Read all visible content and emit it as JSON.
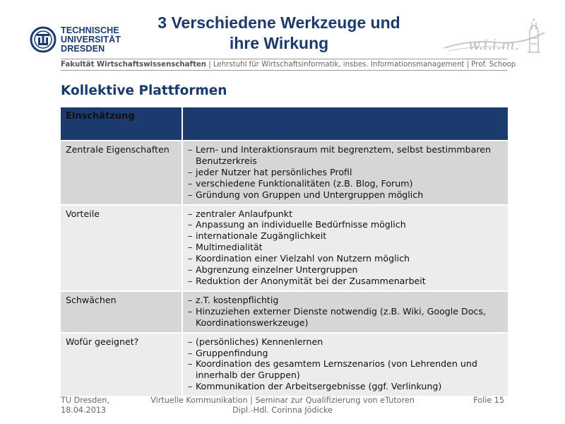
{
  "header": {
    "logo_lines": [
      "TECHNISCHE",
      "UNIVERSITÄT",
      "DRESDEN"
    ],
    "title_lines": [
      "3 Verschiedene Werkzeuge und",
      "ihre Wirkung"
    ],
    "wiim_logo_text": "w.i.i.m.",
    "faculty_bold": "Fakultät Wirtschaftswissenschaften",
    "faculty_rest": " | Lehrstuhl für Wirtschaftsinformatik, insbes. Informationsmanagement | Prof. Schoop"
  },
  "section_title": "Kollektive Plattformen",
  "table": {
    "header": [
      "Einschätzung",
      ""
    ],
    "rows": [
      {
        "label": "Zentrale Eigenschaften",
        "points": [
          "Lern- und Interaktionsraum mit begrenztem, selbst bestimmbaren Benutzerkreis",
          "jeder Nutzer hat persönliches Profil",
          "verschiedene Funktionalitäten (z.B. Blog, Forum)",
          "Gründung von Gruppen und Untergruppen möglich"
        ]
      },
      {
        "label": "Vorteile",
        "points": [
          "zentraler Anlaufpunkt",
          "Anpassung an individuelle Bedürfnisse möglich",
          "internationale Zugänglichkeit",
          "Multimedialität",
          "Koordination einer Vielzahl von Nutzern möglich",
          "Abgrenzung einzelner Untergruppen",
          "Reduktion der Anonymität bei der Zusammenarbeit"
        ]
      },
      {
        "label": "Schwächen",
        "points": [
          "z.T. kostenpflichtig",
          "Hinzuziehen externer Dienste notwendig (z.B. Wiki, Google Docs, Koordinationswerkzeuge)"
        ]
      },
      {
        "label": "Wofür geeignet?",
        "points": [
          "(persönliches) Kennenlernen",
          "Gruppenfindung",
          "Koordination des gesamtem Lernszenarios (von Lehrenden und innerhalb der Gruppen)",
          "Kommunikation der Arbeitsergebnisse (ggf. Verlinkung)"
        ]
      }
    ]
  },
  "footer": {
    "left_lines": [
      "TU Dresden,",
      "18.04.2013"
    ],
    "center_lines": [
      "Virtuelle Kommunikation | Seminar zur Qualifizierung von eTutoren",
      "Dipl.-Hdl. Corinna Jödicke"
    ],
    "right": "Folie 15"
  },
  "colors": {
    "brand_blue": "#1b3a6e",
    "row_dark": "#d6d6d6",
    "row_light": "#ececec",
    "muted_text": "#666666"
  }
}
